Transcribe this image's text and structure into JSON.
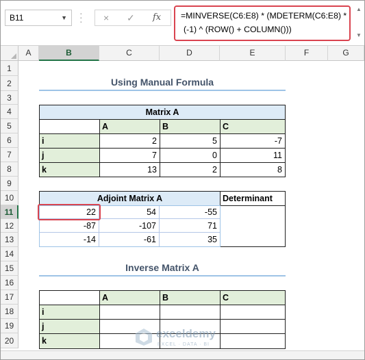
{
  "name_box": {
    "value": "B11"
  },
  "formula_bar": {
    "cancel_icon": "×",
    "enter_icon": "✓",
    "fx_label": "fx",
    "formula_line1": "=MINVERSE(C6:E8) * (MDETERM(C6:E8) *",
    "formula_line2": "(-1) ^ (ROW() + COLUMN()))"
  },
  "columns": [
    "A",
    "B",
    "C",
    "D",
    "E",
    "F",
    "G"
  ],
  "rows": [
    "1",
    "2",
    "3",
    "4",
    "5",
    "6",
    "7",
    "8",
    "9",
    "10",
    "11",
    "12",
    "13",
    "14",
    "15",
    "16",
    "17",
    "18",
    "19",
    "20"
  ],
  "selected_cell": "B11",
  "title_manual": "Using Manual Formula",
  "matrix_a": {
    "title": "Matrix A",
    "headers": [
      "A",
      "B",
      "C"
    ],
    "row_labels": [
      "i",
      "j",
      "k"
    ],
    "values": [
      [
        "2",
        "5",
        "-7"
      ],
      [
        "7",
        "0",
        "11"
      ],
      [
        "13",
        "2",
        "8"
      ]
    ]
  },
  "adjoint": {
    "title": "Adjoint Matrix A",
    "values": [
      [
        "22",
        "54",
        "-55"
      ],
      [
        "-87",
        "-107",
        "71"
      ],
      [
        "-14",
        "-61",
        "35"
      ]
    ]
  },
  "determinant": {
    "header": "Determinant"
  },
  "title_inverse": "Inverse Matrix A",
  "inverse": {
    "headers": [
      "A",
      "B",
      "C"
    ],
    "row_labels": [
      "i",
      "j",
      "k"
    ]
  },
  "watermark": {
    "name": "exceldemy",
    "tagline": "EXCEL · DATA · BI"
  },
  "colors": {
    "accent_red": "#d9434f",
    "header_blue": "#ddebf7",
    "label_green": "#e2efda",
    "excel_green": "#217346"
  }
}
